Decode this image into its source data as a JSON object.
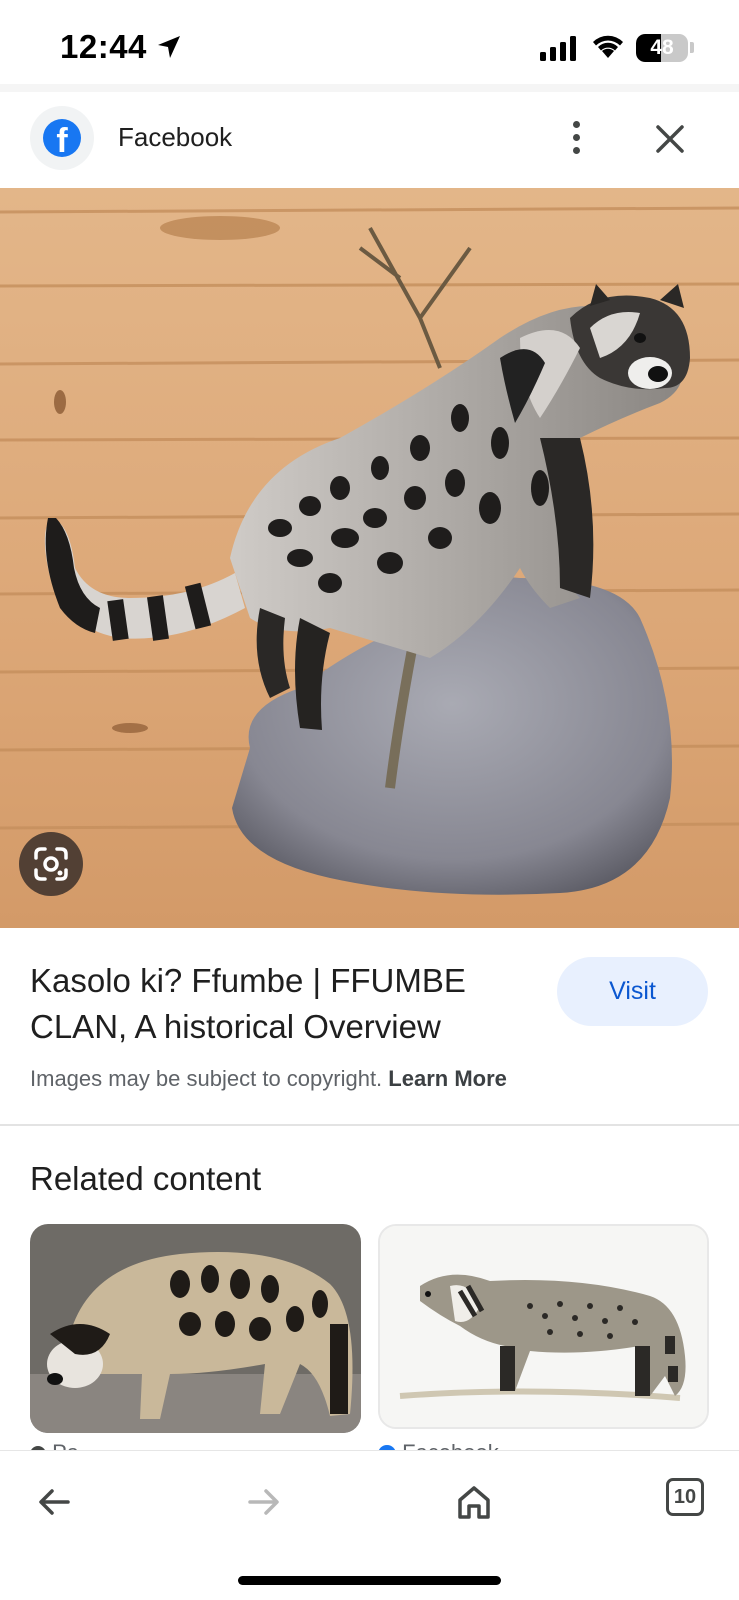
{
  "status_bar": {
    "time": "12:44",
    "battery_level": "48",
    "battery_fraction": 0.48,
    "icons": [
      "location-arrow-icon",
      "cellular-signal-icon",
      "wifi-icon",
      "battery-icon"
    ]
  },
  "header": {
    "site_name": "Facebook",
    "logo_letter": "f",
    "colors": {
      "facebook_blue": "#1877f2"
    },
    "icons": [
      "facebook-logo-icon",
      "more-vert-icon",
      "close-icon"
    ]
  },
  "hero": {
    "image_description_icon": "civet-on-rock-image",
    "lens_icon": "google-lens-icon"
  },
  "result": {
    "title": "Kasolo ki? Ffumbe | FFUMBE CLAN, A historical Overview",
    "visit_label": "Visit",
    "copyright_text": "Images may be subject to copyright.",
    "learn_more_label": "Learn More"
  },
  "related": {
    "heading": "Related content",
    "items": [
      {
        "source": "Pa...",
        "source_icon": "site-favicon-icon"
      },
      {
        "source": "Facebook",
        "source_icon": "facebook-logo-icon"
      }
    ]
  },
  "bottom_nav": {
    "tabs_count": "10",
    "icons": [
      "back-arrow-icon",
      "forward-arrow-icon",
      "home-icon",
      "tabs-icon"
    ]
  },
  "colors": {
    "visit_bg": "#e8f0fe",
    "visit_text": "#0b57d0",
    "muted_text": "#5f6368"
  }
}
